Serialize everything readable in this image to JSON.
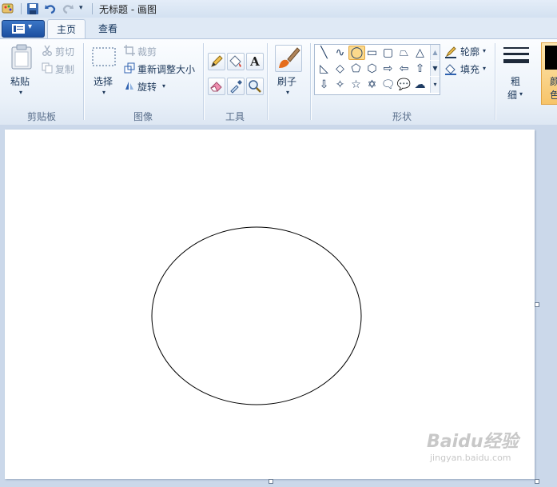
{
  "window": {
    "title": "无标题 - 画图"
  },
  "tabs": {
    "home": "主页",
    "view": "查看"
  },
  "clipboard": {
    "paste": "粘贴",
    "cut": "剪切",
    "copy": "复制",
    "group_label": "剪贴板"
  },
  "image": {
    "select": "选择",
    "crop": "裁剪",
    "resize": "重新调整大小",
    "rotate": "旋转",
    "group_label": "图像"
  },
  "tools": {
    "group_label": "工具",
    "text_glyph": "A"
  },
  "brushes": {
    "label": "刷子"
  },
  "shapes": {
    "group_label": "形状",
    "outline": "轮廓",
    "fill": "填充",
    "row1": [
      "╲",
      "∿",
      "◯",
      "▭",
      "▢",
      "⏢",
      "△"
    ],
    "row2": [
      "◺",
      "◇",
      "⬠",
      "⬡",
      "⇨",
      "⇦",
      "⇧"
    ],
    "row3": [
      "⇩",
      "✧",
      "☆",
      "✡",
      "🗨",
      "💬",
      "☁"
    ]
  },
  "size": {
    "label_1": "粗",
    "label_2": "细"
  },
  "colors": {
    "label_1": "颜",
    "label_2": "色",
    "color1": "#000000"
  },
  "watermark": {
    "text": "Baidu经验",
    "url": "jingyan.baidu.com"
  }
}
